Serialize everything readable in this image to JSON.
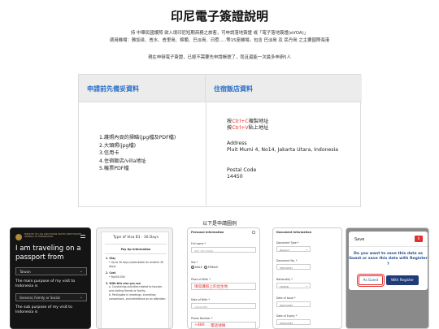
{
  "page": {
    "title": "印尼電子簽證說明",
    "intro_line1": "持 中華民國護照 欲入境印尼短期商務之旅客，可申請落地簽證 或「電子落地簽證(eVOA)」",
    "intro_line2": "適用機場：雅加達、峇水、峇里島、棉蘭、巴淡島、日惹.....等15座機場，包含 巴淡島 及 民丹島 之主要國際海港",
    "note": "現在申辦電子簽證，已經不需要先申請帳號了，而且還能一次最多申辦5人"
  },
  "table": {
    "left_header": "申請前先備妥資料",
    "right_header": "住宿飯店資料",
    "requirements": [
      "1.護照內頁的掃瞄(jpg檔及PDF檔)",
      "2.大頭照(jpg檔)",
      "3.信用卡",
      "4.住宿飯店/villa地址",
      "5.機票PDF檔"
    ],
    "copy_pre": "按",
    "copy_key": "Ctrl+C",
    "copy_post": "複製地址",
    "paste_pre": "按",
    "paste_key": "Ctrl+V",
    "paste_post": "貼上地址",
    "address_label": "Address",
    "address_value": "Pluit Mumi 4, No14, Jakarta Utara, Indonesia",
    "postal_label": "Postal Code",
    "postal_value": "14450"
  },
  "examples": {
    "label": "以下是申請圖例",
    "shot1": {
      "org": "MINISTRY OF LAW AND HUMAN RIGHTS DIRECTORATE GENERAL OF IMMIGRATION",
      "heading": "I am traveling on a passport from",
      "passport_value": "Taiwan",
      "purpose_question": "The main purpose of my visit to Indonesia is",
      "purpose_value": "General, Family or Social",
      "sub_question": "The sub purpose of my visit to Indonesia is"
    },
    "shot2": {
      "title": "Type of Visa B1 - 30 Days",
      "subtitle": "Pay Up Information",
      "stay_label": "1. Stay",
      "stay_detail": "• Up to 30 days (extendable for another 30 days)",
      "cost_label": "2. Cost",
      "cost_detail": "• Rp500.000",
      "do_label": "3. With this visa you can",
      "do_items": [
        "a. Conducting activities related to tourism, and visiting friends or family;",
        "b. Participate in meetings, incentives, conventions, and exhibitions as an attendee;"
      ]
    },
    "shot3": {
      "header": "Personal Information",
      "full_name_label": "Full name *",
      "full_name_value": "WEY YIN CHUAN",
      "sex_label": "Sex *",
      "male": "MALE",
      "female": "FEMALE",
      "pob_label": "Place of Birth *",
      "pob_value": "填寫護照上的出生地",
      "dob_label": "Date of Birth *",
      "dob_value": "19/04/1985",
      "phone_label": "Phone Number *",
      "phone_code": "+886",
      "phone_value": "電話號碼"
    },
    "shot4": {
      "header": "Document Information",
      "doc_type_label": "Document Type *",
      "doc_type_value": "Passport",
      "doc_no_label": "Document No. *",
      "doc_no_value": "385232201",
      "nationality_label": "Nationality *",
      "nationality_value": "TAIWAN",
      "issue_label": "Date of Issue *",
      "issue_value": "06/07/2020",
      "expiry_label": "Date of Expiry *",
      "expiry_value": "09/05/2029"
    },
    "shot5": {
      "title": "Save",
      "close": "X",
      "message": "Do you want to save this data as Guest or save this data with Register ?",
      "guest_button": "As Guest",
      "register_button": "With Register"
    }
  },
  "colors": {
    "accent_blue": "#2b6fc9",
    "key_red": "#e0312f",
    "header_gray": "#ececec"
  }
}
